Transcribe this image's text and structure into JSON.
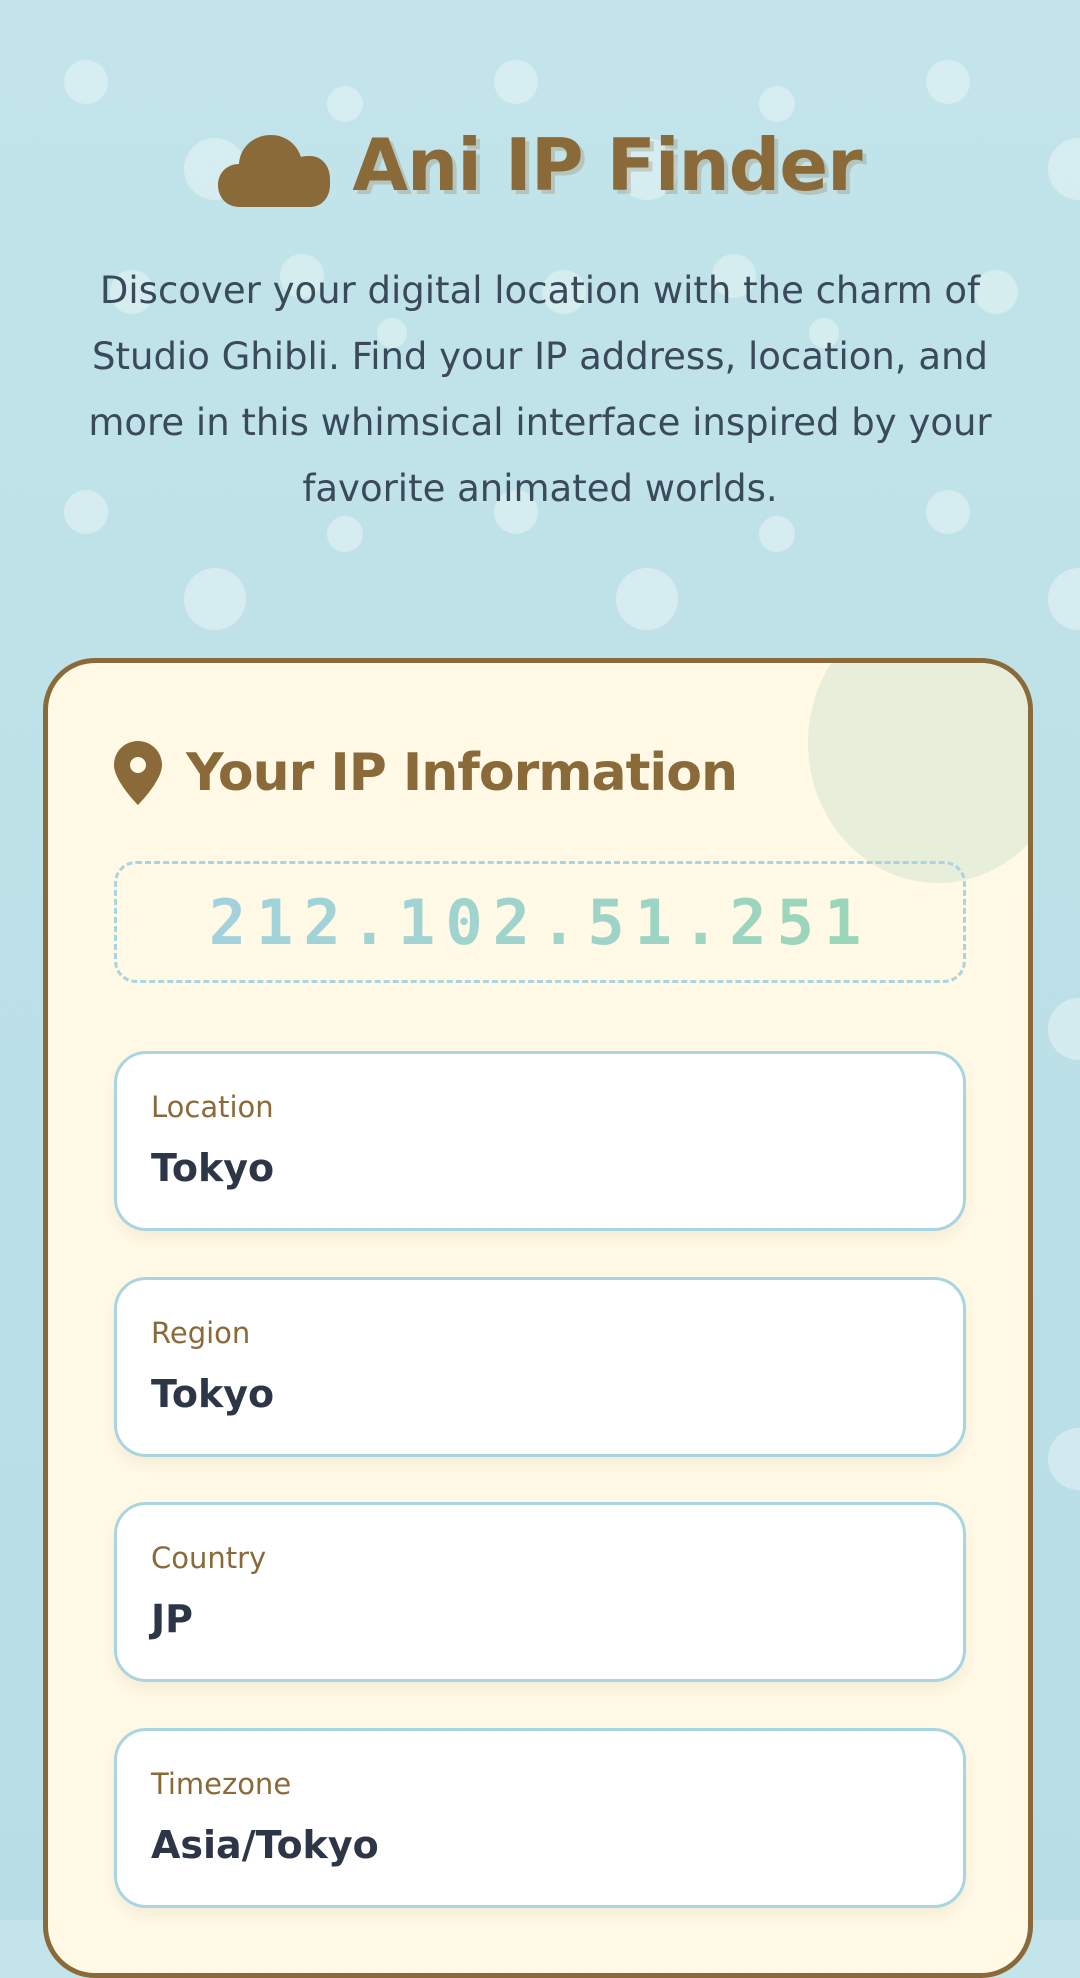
{
  "app": {
    "title": "Ani IP Finder",
    "description": "Discover your digital location with the charm of Studio Ghibli. Find your IP address, location, and more in this whimsical interface inspired by your favorite animated worlds.",
    "logo_icon": "cloud-icon"
  },
  "card": {
    "title": "Your IP Information",
    "title_icon": "map-pin-icon",
    "ip_address": "212.102.51.251",
    "fields": [
      {
        "label": "Location",
        "value": "Tokyo"
      },
      {
        "label": "Region",
        "value": "Tokyo"
      },
      {
        "label": "Country",
        "value": "JP"
      },
      {
        "label": "Timezone",
        "value": "Asia/Tokyo"
      }
    ]
  },
  "colors": {
    "background": "#c2e4ea",
    "brand_brown": "#8b6a3a",
    "card_background": "#fff9e6",
    "field_border": "#a9d4e2",
    "text_dark": "#2c3646"
  }
}
